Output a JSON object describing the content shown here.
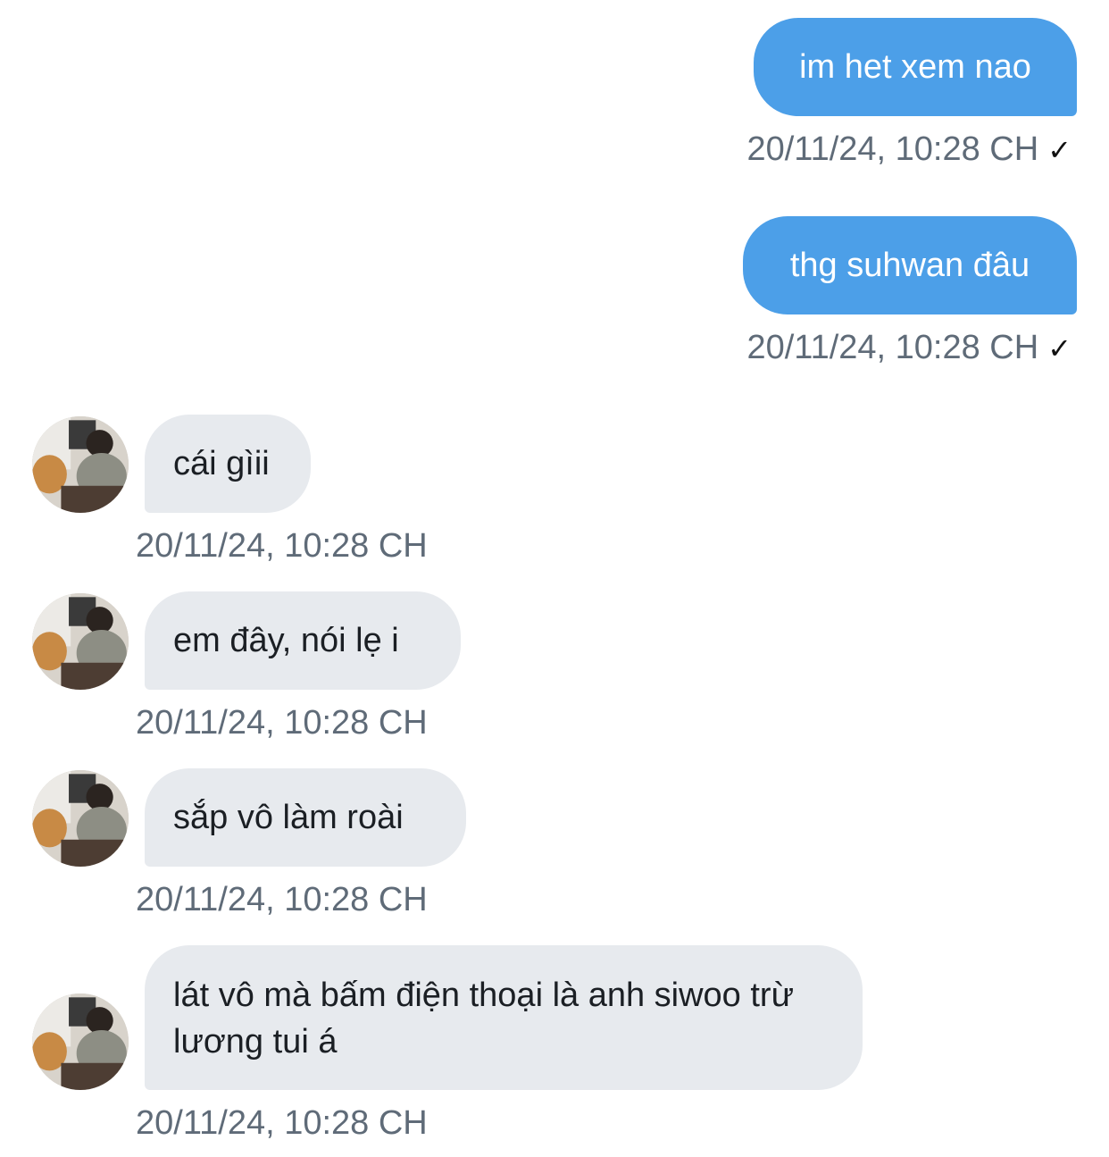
{
  "messages": [
    {
      "direction": "sent",
      "text": "im het xem nao",
      "timestamp": "20/11/24, 10:28 CH",
      "status_icon": "checkmark-icon"
    },
    {
      "direction": "sent",
      "text": "thg suhwan đâu",
      "timestamp": "20/11/24, 10:28 CH",
      "status_icon": "checkmark-icon"
    },
    {
      "direction": "received",
      "text": "cái gìii",
      "timestamp": "20/11/24, 10:28 CH"
    },
    {
      "direction": "received",
      "text": "em đây, nói lẹ i",
      "timestamp": "20/11/24, 10:28 CH"
    },
    {
      "direction": "received",
      "text": "sắp vô làm roài",
      "timestamp": "20/11/24, 10:28 CH"
    },
    {
      "direction": "received",
      "text": "lát vô mà bấm điện thoại là anh siwoo trừ lương tui á",
      "timestamp": "20/11/24, 10:28 CH"
    }
  ],
  "check_glyph": "✓",
  "colors": {
    "sent_bubble": "#4c9fe8",
    "received_bubble": "#e7eaee",
    "timestamp": "#5f6b78"
  }
}
